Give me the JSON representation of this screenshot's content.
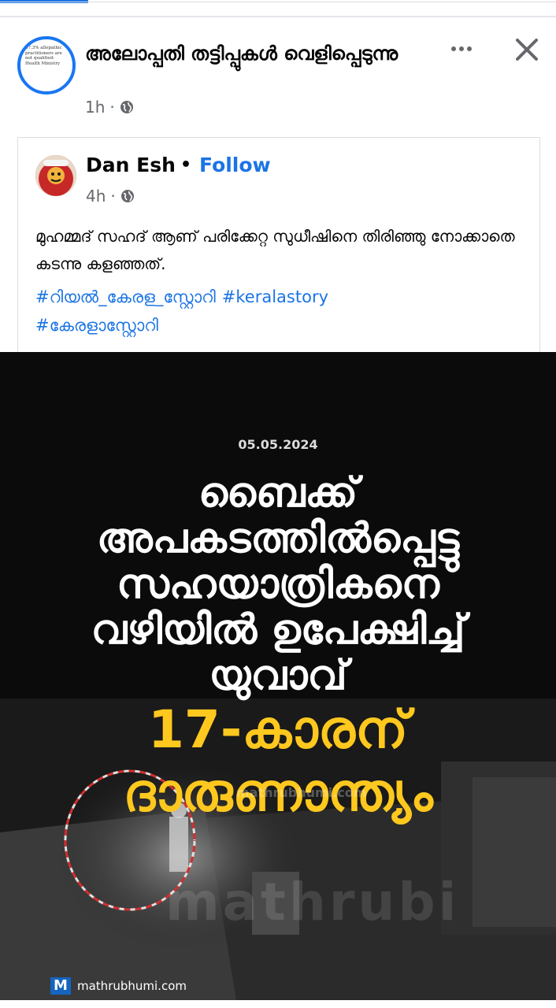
{
  "group_post": {
    "title": "അലോപ്പതി തട്ടിപ്പുകൾ വെളിപ്പെടുന്നു",
    "time": "1h",
    "avatar_text": "57.3% allopathic practitioners are not qualified: Health Ministry"
  },
  "shared_post": {
    "author": "Dan Esh",
    "separator": "•",
    "follow_label": "Follow",
    "time": "4h",
    "text": "മുഹമ്മദ് സഹദ് ആണ് പരിക്കേറ്റ സുധീഷിനെ തിരിഞ്ഞു നോക്കാതെ കടന്നു കളഞ്ഞത്.",
    "hashtags": [
      "#റിയൽ_കേരള_സ്റ്റോറി",
      "#keralastory",
      "#കേരളാസ്റ്റോറി"
    ]
  },
  "media": {
    "date": "05.05.2024",
    "headline_lines": [
      "ബൈക്ക്",
      "അപകടത്തിൽപ്പെട്ടു",
      "സഹയാത്രികനെ",
      "വഴിയിൽ ഉപേക്ഷിച്ച്",
      "യുവാവ്"
    ],
    "highlight_lines": [
      "17-കാരന്",
      "ദാരുണാന്ത്യം"
    ],
    "watermark_small": "mathrubhumi.com",
    "watermark_big": "mathrubi",
    "source_logo": "M",
    "source_text": "mathrubhumi.com"
  },
  "colors": {
    "accent": "#1b74e4",
    "headline_yellow": "#ffc81e",
    "media_bg": "#0b0b0b"
  },
  "icons": [
    "more-options-icon",
    "close-icon",
    "globe-icon"
  ]
}
